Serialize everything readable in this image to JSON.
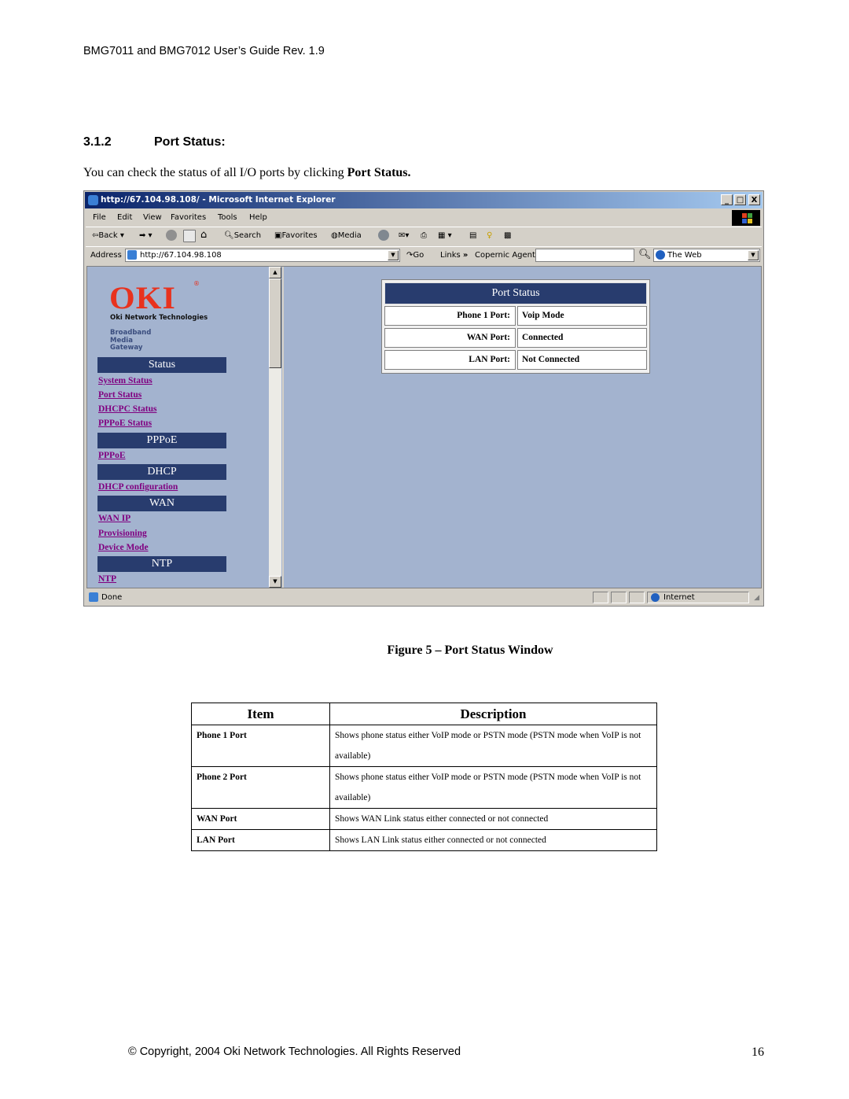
{
  "document": {
    "header": "BMG7011 and BMG7012 User’s Guide Rev. 1.9",
    "section_number": "3.1.2",
    "section_title": "Port Status:",
    "intro_text": "You can check the status of all I/O ports by clicking ",
    "intro_bold": "Port Status.",
    "figure_caption": "Figure 5 – Port Status Window",
    "footer": "© Copyright, 2004 Oki Network Technologies. All Rights Reserved",
    "page_number": "16"
  },
  "browser": {
    "title": "http://67.104.98.108/ - Microsoft Internet Explorer",
    "window_buttons": [
      "_",
      "□",
      "X"
    ],
    "menu": [
      "File",
      "Edit",
      "View",
      "Favorites",
      "Tools",
      "Help"
    ],
    "toolbar": {
      "back": "Back",
      "search": "Search",
      "favorites": "Favorites",
      "media": "Media"
    },
    "address_label": "Address",
    "address_value": "http://67.104.98.108",
    "go_label": "Go",
    "links_label": "Links",
    "links_chevron": "»",
    "copernic_label": "Copernic Agent",
    "copernic_value": "",
    "search_scope": "The Web",
    "status_text": "Done",
    "zone_text": "Internet"
  },
  "webpage": {
    "logo": "OKI",
    "logo_reg": "®",
    "company": "Oki Network Technologies",
    "tagline": [
      "Broadband",
      "Media",
      "Gateway"
    ],
    "nav": [
      {
        "heading": "Status",
        "links": [
          "System Status",
          "Port Status",
          "DHCPC Status",
          "PPPoE Status"
        ]
      },
      {
        "heading": "PPPoE",
        "links": [
          "PPPoE"
        ]
      },
      {
        "heading": "DHCP",
        "links": [
          "DHCP configuration"
        ]
      },
      {
        "heading": "WAN",
        "links": [
          "WAN IP",
          "Provisioning",
          "Device Mode"
        ]
      },
      {
        "heading": "NTP",
        "links": [
          "NTP"
        ]
      }
    ],
    "port_status": {
      "title": "Port Status",
      "rows": [
        {
          "label": "Phone 1 Port:",
          "value": "Voip Mode"
        },
        {
          "label": "WAN Port:",
          "value": "Connected"
        },
        {
          "label": "LAN Port:",
          "value": "Not Connected"
        }
      ]
    }
  },
  "desc_table": {
    "headers": [
      "Item",
      "Description"
    ],
    "rows": [
      {
        "item": "Phone 1 Port",
        "description": "Shows phone status either VoIP mode or PSTN mode (PSTN mode when VoIP is not available)"
      },
      {
        "item": "Phone 2 Port",
        "description": "Shows phone status either VoIP mode or PSTN mode (PSTN mode when VoIP is not available)"
      },
      {
        "item": "WAN Port",
        "description": "Shows WAN Link status either connected or not connected"
      },
      {
        "item": "LAN Port",
        "description": "Shows LAN Link status either connected or not connected"
      }
    ]
  }
}
